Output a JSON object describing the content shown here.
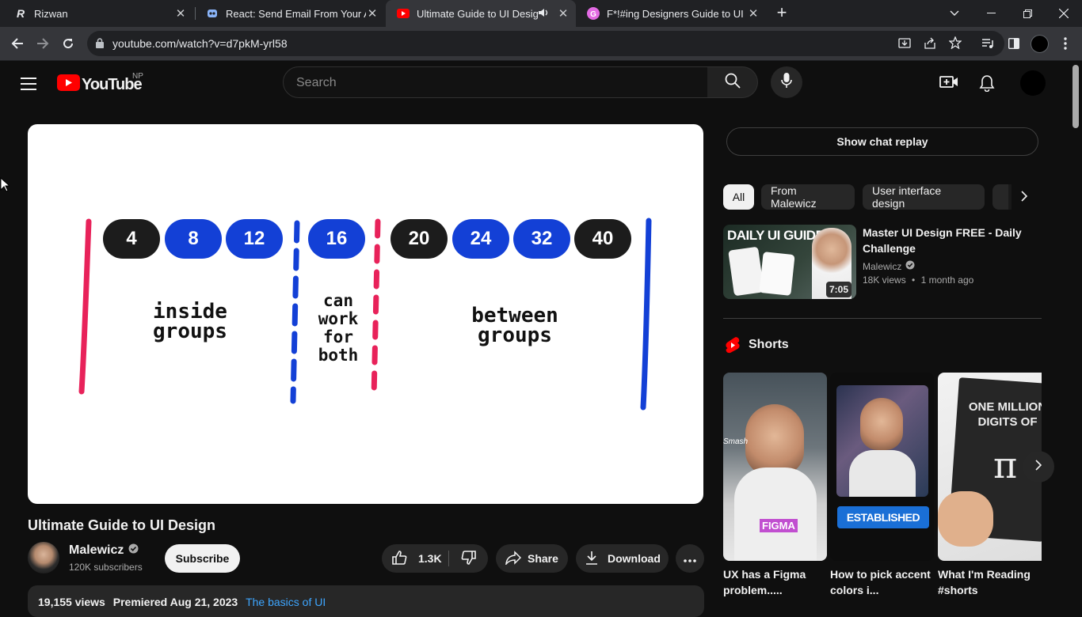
{
  "browser": {
    "tabs": [
      {
        "title": "Rizwan"
      },
      {
        "title": "React: Send Email From Your App"
      },
      {
        "title": "Ultimate Guide to UI Design"
      },
      {
        "title": "F*!#ing Designers Guide to UI"
      }
    ],
    "url": "youtube.com/watch?v=d7pkM-yrl58"
  },
  "youtube": {
    "logo_text": "YouTube",
    "country_code": "NP",
    "search_placeholder": "Search"
  },
  "video": {
    "title": "Ultimate Guide to UI Design",
    "channel": "Malewicz",
    "subscribers": "120K subscribers",
    "subscribe_label": "Subscribe",
    "likes": "1.3K",
    "share_label": "Share",
    "download_label": "Download",
    "views": "19,155 views",
    "premiered": "Premiered Aug 21, 2023",
    "playlist": "The basics of UI",
    "frame": {
      "pills": [
        "4",
        "8",
        "12",
        "16",
        "20",
        "24",
        "32",
        "40"
      ],
      "label_inside": "inside groups",
      "label_both": "can work for both",
      "label_between": "between groups"
    }
  },
  "sidebar": {
    "chat_replay": "Show chat replay",
    "chips": [
      "All",
      "From Malewicz",
      "User interface design"
    ],
    "recommended": {
      "thumb_text": "DAILY UI GUIDE",
      "title": "Master UI Design FREE - Daily Challenge",
      "channel": "Malewicz",
      "views": "18K views",
      "age": "1 month ago",
      "duration": "7:05"
    },
    "shorts_label": "Shorts",
    "shorts": [
      {
        "title": "UX has a Figma problem.....",
        "overlay": "FIGMA",
        "tag": "Smash"
      },
      {
        "title": "How to pick accent colors i...",
        "overlay": "ESTABLISHED"
      },
      {
        "title": "What I'm Reading #shorts",
        "overlay": "ONE MILLION DIGITS OF"
      }
    ]
  },
  "colors": {
    "black_pill": "#1c1c1c",
    "blue_pill": "#1340d6",
    "red_line": "#e8225a",
    "blue_line": "#1340d6",
    "yt_red": "#ff0000",
    "link": "#3ea6ff"
  }
}
